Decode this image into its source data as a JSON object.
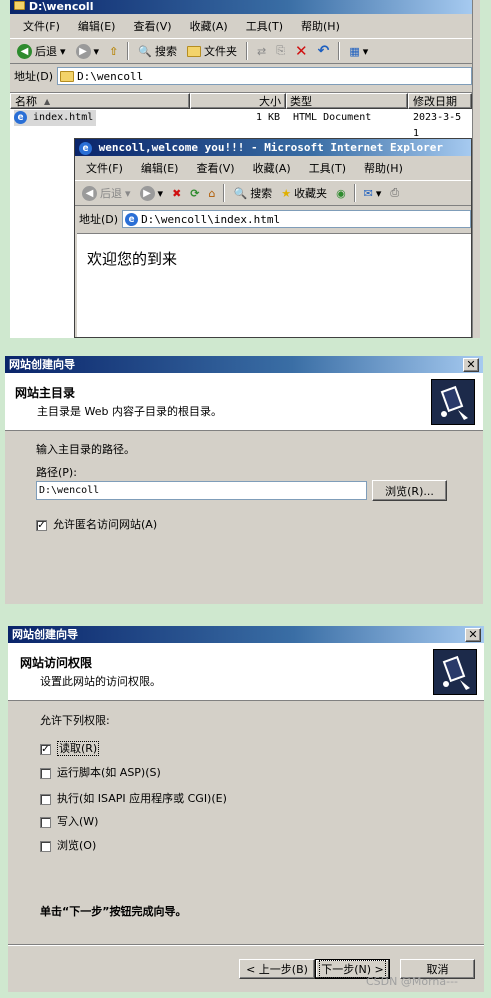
{
  "explorer": {
    "title": "D:\\wencoll",
    "menu": [
      "文件(F)",
      "编辑(E)",
      "查看(V)",
      "收藏(A)",
      "工具(T)",
      "帮助(H)"
    ],
    "toolbar": {
      "back": "后退",
      "search": "搜索",
      "folders": "文件夹"
    },
    "address_label": "地址(D)",
    "address_value": "D:\\wencoll",
    "columns": [
      "名称",
      "大小",
      "类型",
      "修改日期"
    ],
    "file": {
      "name": "index.html",
      "size": "1 KB",
      "type": "HTML Document",
      "date": "2023-3-5 1"
    }
  },
  "ie": {
    "title": "wencoll,welcome you!!! - Microsoft Internet Explorer",
    "menu": [
      "文件(F)",
      "编辑(E)",
      "查看(V)",
      "收藏(A)",
      "工具(T)",
      "帮助(H)"
    ],
    "toolbar": {
      "back": "后退",
      "search": "搜索",
      "favorites": "收藏夹"
    },
    "address_label": "地址(D)",
    "address_value": "D:\\wencoll\\index.html",
    "content": "欢迎您的到来"
  },
  "wizard1": {
    "title": "网站创建向导",
    "header_title": "网站主目录",
    "header_sub": "主目录是 Web 内容子目录的根目录。",
    "prompt": "输入主目录的路径。",
    "path_label": "路径(P):",
    "path_value": "D:\\wencoll",
    "browse": "浏览(R)...",
    "anonymous": "允许匿名访问网站(A)",
    "anonymous_checked": true
  },
  "wizard2": {
    "title": "网站创建向导",
    "header_title": "网站访问权限",
    "header_sub": "设置此网站的访问权限。",
    "prompt": "允许下列权限:",
    "perms": [
      {
        "label": "读取(R)",
        "checked": true
      },
      {
        "label": "运行脚本(如 ASP)(S)",
        "checked": false
      },
      {
        "label": "执行(如 ISAPI 应用程序或 CGI)(E)",
        "checked": false
      },
      {
        "label": "写入(W)",
        "checked": false
      },
      {
        "label": "浏览(O)",
        "checked": false
      }
    ],
    "finish_hint": "单击“下一步”按钮完成向导。",
    "back": "< 上一步(B)",
    "next": "下一步(N) >",
    "cancel": "取消"
  },
  "watermark": "CSDN @Morna---"
}
